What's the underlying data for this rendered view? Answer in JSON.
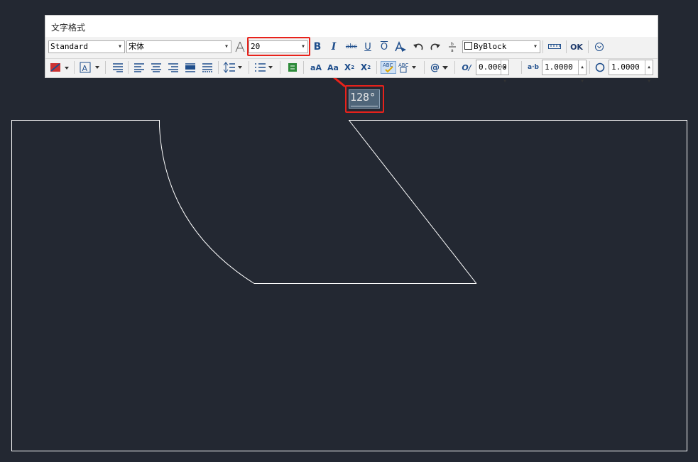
{
  "window": {
    "title": "文字格式"
  },
  "toolbar1": {
    "style_value": "Standard",
    "font_value": "宋体",
    "height_value": "20",
    "bold_label": "B",
    "italic_label": "I",
    "strike_label": "abc",
    "underline_label": "U",
    "overline_label": "O",
    "color_value": "ByBlock",
    "ok_label": "OK"
  },
  "toolbar2": {
    "lowercase_label": "aA",
    "uppercase_label": "Aa",
    "superscript_label": "X",
    "superscript_mark": "2",
    "subscript_label": "X",
    "subscript_mark": "2",
    "insert_field_label": "@",
    "oblique_label": "O/",
    "oblique_value": "0.0000",
    "tracking_label": "a·b",
    "tracking_value": "1.0000",
    "width_factor_value": "1.0000"
  },
  "canvas": {
    "angle_input_value": "128°"
  },
  "colors": {
    "background": "#232832",
    "highlight": "#e8221b",
    "accent": "#1f4e8c"
  },
  "icons": [
    "font-icon",
    "text-color-icon",
    "mask-icon",
    "justify-icon",
    "align-left-icon",
    "align-center-icon",
    "align-right-icon",
    "align-justify-icon",
    "distribute-icon",
    "line-spacing-icon",
    "numbering-icon",
    "field-icon",
    "spellcheck-icon",
    "dictionary-icon",
    "undo-icon",
    "redo-icon",
    "stack-icon",
    "ruler-icon",
    "options-icon",
    "width-icon"
  ]
}
